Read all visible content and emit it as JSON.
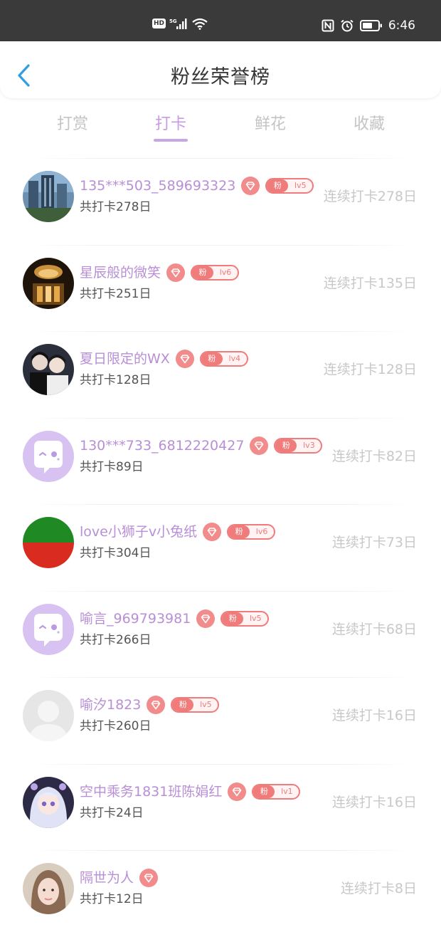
{
  "status_bar": {
    "hd_label": "HD",
    "network_label": "5G",
    "time": "6:46"
  },
  "header": {
    "title": "粉丝荣誉榜",
    "back_icon": "chevron-left-icon",
    "accent_color": "#2f9fe0"
  },
  "tabs": [
    {
      "label": "打赏",
      "active": false
    },
    {
      "label": "打卡",
      "active": true
    },
    {
      "label": "鲜花",
      "active": false
    },
    {
      "label": "收藏",
      "active": false
    }
  ],
  "colors": {
    "active_tab": "#c89ce0",
    "username": "#b88fd6",
    "badge": "#f07b7b",
    "streak_text": "#c8c8c8"
  },
  "fan_badge_label": "粉",
  "rows": [
    {
      "username": "135***503_589693323",
      "level": "lv5",
      "total": "共打卡278日",
      "streak": "连续打卡278日",
      "avatar": "city-building-photo"
    },
    {
      "username": "星辰般的微笑",
      "level": "lv6",
      "total": "共打卡251日",
      "streak": "连续打卡135日",
      "avatar": "golden-chandelier-photo"
    },
    {
      "username": "夏日限定的WX",
      "level": "lv4",
      "total": "共打卡128日",
      "streak": "连续打卡128日",
      "avatar": "two-people-photo"
    },
    {
      "username": "130***733_6812220427",
      "level": "lv3",
      "total": "共打卡89日",
      "streak": "连续打卡82日",
      "avatar": "default-chat-bubble-avatar"
    },
    {
      "username": "love小狮子v小兔纸",
      "level": "lv6",
      "total": "共打卡304日",
      "streak": "连续打卡73日",
      "avatar": "green-red-split-avatar"
    },
    {
      "username": "喻言_969793981",
      "level": "lv5",
      "total": "共打卡266日",
      "streak": "连续打卡68日",
      "avatar": "default-chat-bubble-avatar"
    },
    {
      "username": "喻汐1823",
      "level": "lv5",
      "total": "共打卡260日",
      "streak": "连续打卡16日",
      "avatar": "grey-person-placeholder"
    },
    {
      "username": "空中乘务1831班陈娟红",
      "level": "lv1",
      "total": "共打卡24日",
      "streak": "连续打卡16日",
      "avatar": "anime-girl-photo"
    },
    {
      "username": "隔世为人",
      "level": null,
      "total": "共打卡12日",
      "streak": "连续打卡8日",
      "avatar": "woman-portrait-photo"
    }
  ]
}
